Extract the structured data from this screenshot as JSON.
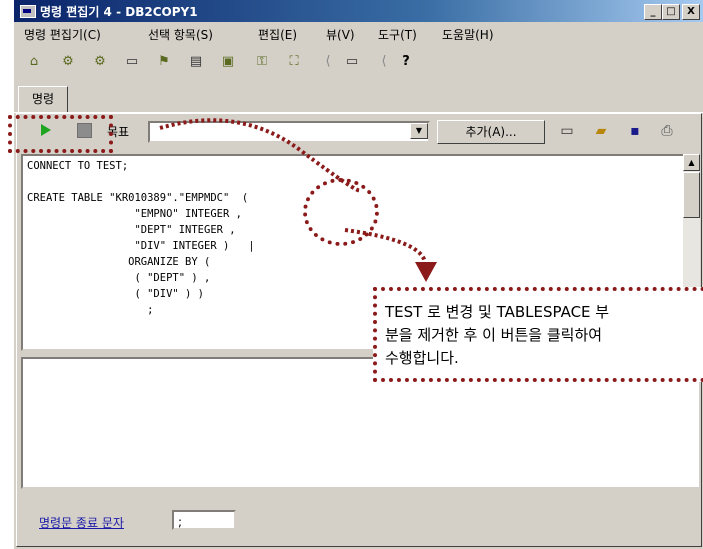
{
  "window": {
    "title": "명령 편집기 4 - DB2COPY1",
    "controls": [
      "_",
      "□",
      "X"
    ]
  },
  "menu": [
    "명령 편집기(C)",
    "선택 항목(S)",
    "편집(E)",
    "뷰(V)",
    "도구(T)",
    "도움말(H)"
  ],
  "tabs": [
    {
      "label": "명령"
    }
  ],
  "command_bar": {
    "target_label": "목표",
    "target_value": "",
    "add_button": "추가(A)..."
  },
  "editor": {
    "code": "CONNECT TO TEST;\n\nCREATE TABLE \"KR010389\".\"EMPMDC\"  (\n                 \"EMPNO\" INTEGER ,\n                 \"DEPT\" INTEGER ,\n                 \"DIV\" INTEGER )   |\n                ORGANIZE BY (\n                 ( \"DEPT\" ) ,\n                 ( \"DIV\" ) )\n                   ;"
  },
  "footer": {
    "terminator_label": "명령문 종료 문자",
    "terminator_value": ";"
  },
  "callout": {
    "lines": [
      "TEST 로 변경 및 TABLESPACE 부",
      "분을 제거한 후 이 버튼을 클릭하여",
      "수행합니다."
    ]
  },
  "colors": {
    "annotation": "#8b1a1a",
    "run": "#1fa51f",
    "titlebar_start": "#0a246a",
    "titlebar_end": "#a6caf0"
  }
}
